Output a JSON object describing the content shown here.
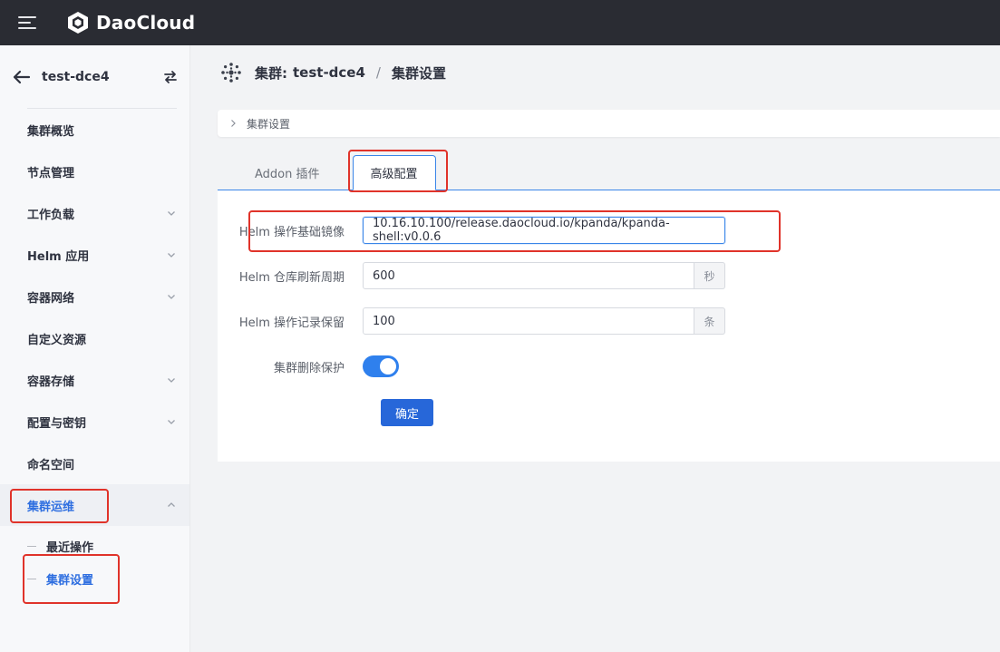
{
  "app": {
    "brand_name": "DaoCloud"
  },
  "sidebar": {
    "cluster_name": "test-dce4",
    "items": [
      {
        "label": "集群概览",
        "expandable": false
      },
      {
        "label": "节点管理",
        "expandable": false
      },
      {
        "label": "工作负载",
        "expandable": true
      },
      {
        "label": "Helm 应用",
        "expandable": true
      },
      {
        "label": "容器网络",
        "expandable": true
      },
      {
        "label": "自定义资源",
        "expandable": false
      },
      {
        "label": "容器存储",
        "expandable": true
      },
      {
        "label": "配置与密钥",
        "expandable": true
      },
      {
        "label": "命名空间",
        "expandable": false
      },
      {
        "label": "集群运维",
        "expandable": true,
        "expanded": true
      }
    ],
    "sub_items": [
      {
        "label": "最近操作"
      },
      {
        "label": "集群设置",
        "active": true
      }
    ]
  },
  "breadcrumb": {
    "prefix": "集群:",
    "cluster": "test-dce4",
    "separator": "/",
    "current": "集群设置"
  },
  "collapse_section": {
    "label": "集群设置"
  },
  "tabs": [
    {
      "label": "Addon 插件"
    },
    {
      "label": "高级配置",
      "active": true
    }
  ],
  "form": {
    "base_image": {
      "label": "Helm 操作基础镜像",
      "value": "10.16.10.100/release.daocloud.io/kpanda/kpanda-shell:v0.0.6"
    },
    "refresh_period": {
      "label": "Helm 仓库刷新周期",
      "value": "600",
      "unit": "秒"
    },
    "record_retention": {
      "label": "Helm 操作记录保留",
      "value": "100",
      "unit": "条"
    },
    "delete_protection": {
      "label": "集群删除保护",
      "enabled": true
    },
    "submit_label": "确定"
  },
  "colors": {
    "topbar": "#2a2c33",
    "primary": "#2767d9",
    "active_text": "#2f6fe0",
    "annotation": "#e0332a"
  }
}
